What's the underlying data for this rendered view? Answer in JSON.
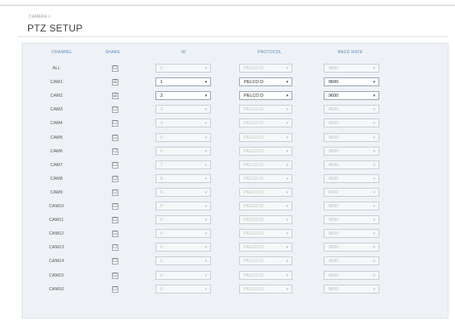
{
  "breadcrumb": "CAMERA >",
  "title": "PTZ SETUP",
  "columns": [
    "CHANNEL",
    "SHARE",
    "ID",
    "PROTOCOL",
    "BAUD RATE"
  ],
  "rows": [
    {
      "channel": "ALL",
      "share": "☐",
      "id": "0",
      "protocol": "PELCO D",
      "baud": "9600",
      "active": false
    },
    {
      "channel": "CAM1",
      "share": "☑",
      "id": "1",
      "protocol": "PELCO D",
      "baud": "9600",
      "active": true
    },
    {
      "channel": "CAM2",
      "share": "☑",
      "id": "2",
      "protocol": "PELCO D",
      "baud": "9600",
      "active": true
    },
    {
      "channel": "CAM3",
      "share": "☐",
      "id": "3",
      "protocol": "PELCO D",
      "baud": "9600",
      "active": false
    },
    {
      "channel": "CAM4",
      "share": "☐",
      "id": "4",
      "protocol": "PELCO D",
      "baud": "9600",
      "active": false
    },
    {
      "channel": "CAM5",
      "share": "☐",
      "id": "5",
      "protocol": "PELCO D",
      "baud": "9600",
      "active": false
    },
    {
      "channel": "CAM6",
      "share": "☐",
      "id": "6",
      "protocol": "PELCO D",
      "baud": "9600",
      "active": false
    },
    {
      "channel": "CAM7",
      "share": "☐",
      "id": "7",
      "protocol": "PELCO D",
      "baud": "9600",
      "active": false
    },
    {
      "channel": "CAM8",
      "share": "☐",
      "id": "8",
      "protocol": "PELCO D",
      "baud": "9600",
      "active": false
    },
    {
      "channel": "CAM9",
      "share": "☐",
      "id": "9",
      "protocol": "PELCO D",
      "baud": "9600",
      "active": false
    },
    {
      "channel": "CAM10",
      "share": "☐",
      "id": "0",
      "protocol": "PELCO D",
      "baud": "9600",
      "active": false
    },
    {
      "channel": "CAM11",
      "share": "☐",
      "id": "0",
      "protocol": "PELCO D",
      "baud": "9600",
      "active": false
    },
    {
      "channel": "CAM12",
      "share": "☐",
      "id": "0",
      "protocol": "PELCO D",
      "baud": "9600",
      "active": false
    },
    {
      "channel": "CAM13",
      "share": "☐",
      "id": "0",
      "protocol": "PELCO D",
      "baud": "9600",
      "active": false
    },
    {
      "channel": "CAM14",
      "share": "☐",
      "id": "0",
      "protocol": "PELCO D",
      "baud": "9600",
      "active": false
    },
    {
      "channel": "CAM15",
      "share": "☐",
      "id": "0",
      "protocol": "PELCO D",
      "baud": "9600",
      "active": false
    },
    {
      "channel": "CAM16",
      "share": "☐",
      "id": "0",
      "protocol": "PELCO D",
      "baud": "9600",
      "active": false
    }
  ],
  "dropdown_arrow": "▾",
  "colors": {
    "header_text": "#5a86b8",
    "table_bg": "#eef2f6"
  }
}
